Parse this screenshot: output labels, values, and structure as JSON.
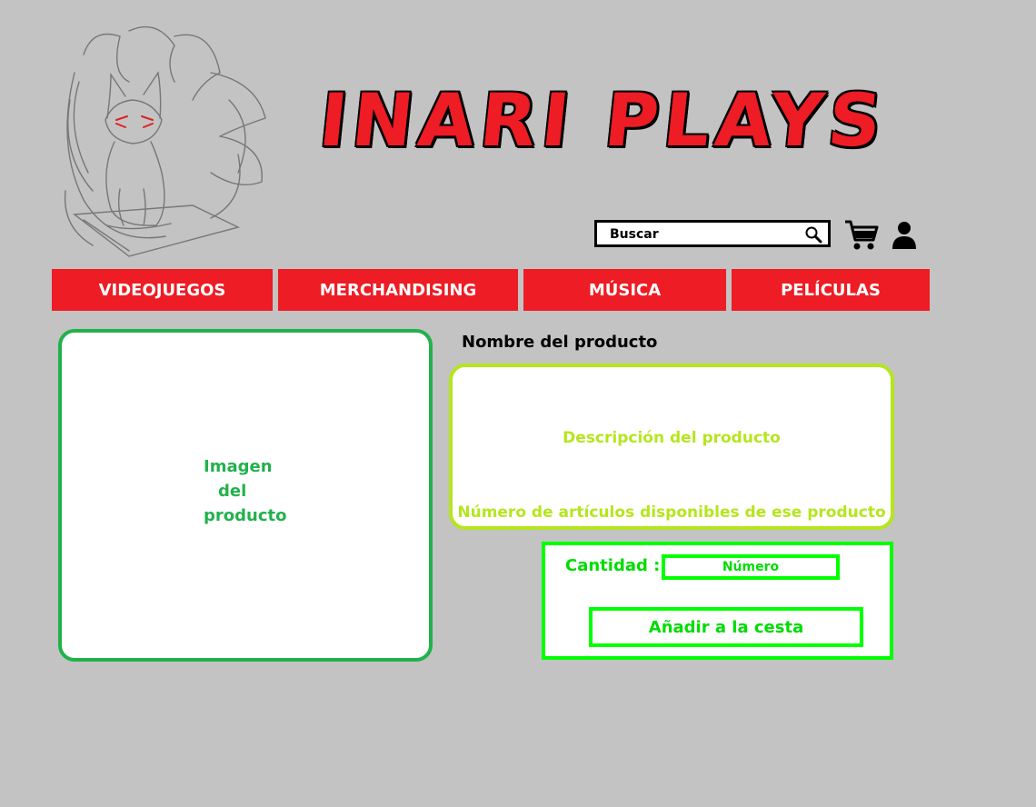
{
  "brand": {
    "title": "INARI PLAYS"
  },
  "search": {
    "placeholder": "Buscar"
  },
  "icons": {
    "logo": "kitsune-fox-sketch",
    "search": "magnifier-icon",
    "cart": "shopping-cart-icon",
    "user": "user-icon"
  },
  "nav": {
    "items": [
      {
        "label": "VIDEOJUEGOS"
      },
      {
        "label": "MERCHANDISING"
      },
      {
        "label": "MÚSICA"
      },
      {
        "label": "PELÍCULAS"
      }
    ]
  },
  "product": {
    "image_label": [
      "Imagen",
      "del",
      "producto"
    ],
    "name": "Nombre del producto",
    "description": "Descripción del producto",
    "stock": "Número de artículos disponibles de ese producto"
  },
  "buy": {
    "quantity_label": "Cantidad :",
    "quantity_placeholder": "Número",
    "add_label": "Añadir a la cesta"
  },
  "colors": {
    "background": "#c3c3c3",
    "nav_red": "#ee1c24",
    "image_green": "#22b14c",
    "desc_lime": "#b5e61d",
    "buy_green": "#00ff00"
  }
}
